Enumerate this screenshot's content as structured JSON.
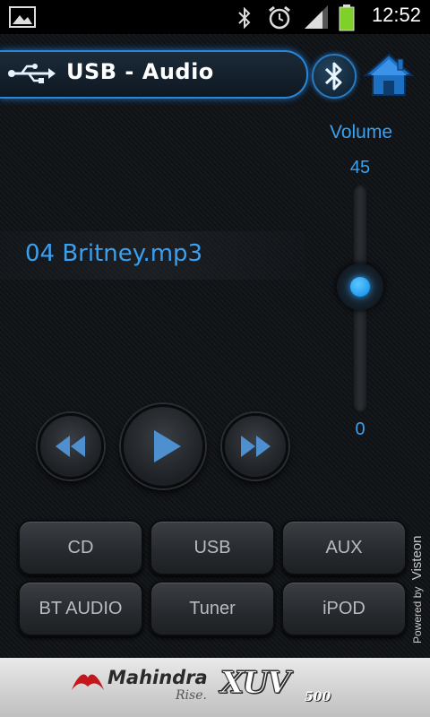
{
  "status_bar": {
    "time": "12:52",
    "icons": [
      "gallery-icon",
      "bluetooth-icon",
      "alarm-icon",
      "signal-icon",
      "battery-icon"
    ]
  },
  "header": {
    "title": "USB - Audio",
    "icons": [
      "usb-icon",
      "bluetooth-icon",
      "home-icon"
    ]
  },
  "player": {
    "track_title": "04 Britney.mp3"
  },
  "volume": {
    "label": "Volume",
    "max_label": "45",
    "min_label": "0",
    "level_fraction": 0.55
  },
  "transport": {
    "icons": [
      "rewind-icon",
      "play-icon",
      "fast-forward-icon"
    ]
  },
  "sources": [
    "CD",
    "USB",
    "AUX",
    "BT AUDIO",
    "Tuner",
    "iPOD"
  ],
  "powered_by": "Powered by",
  "powered_brand": "Visteon",
  "footer": {
    "brand": "Mahindra",
    "tagline": "Rise.",
    "model": "XUV",
    "model_suffix": "500"
  },
  "colors": {
    "accent": "#3aa0f0",
    "header_border": "#2b86d6",
    "button_text": "#b8bcc0"
  }
}
